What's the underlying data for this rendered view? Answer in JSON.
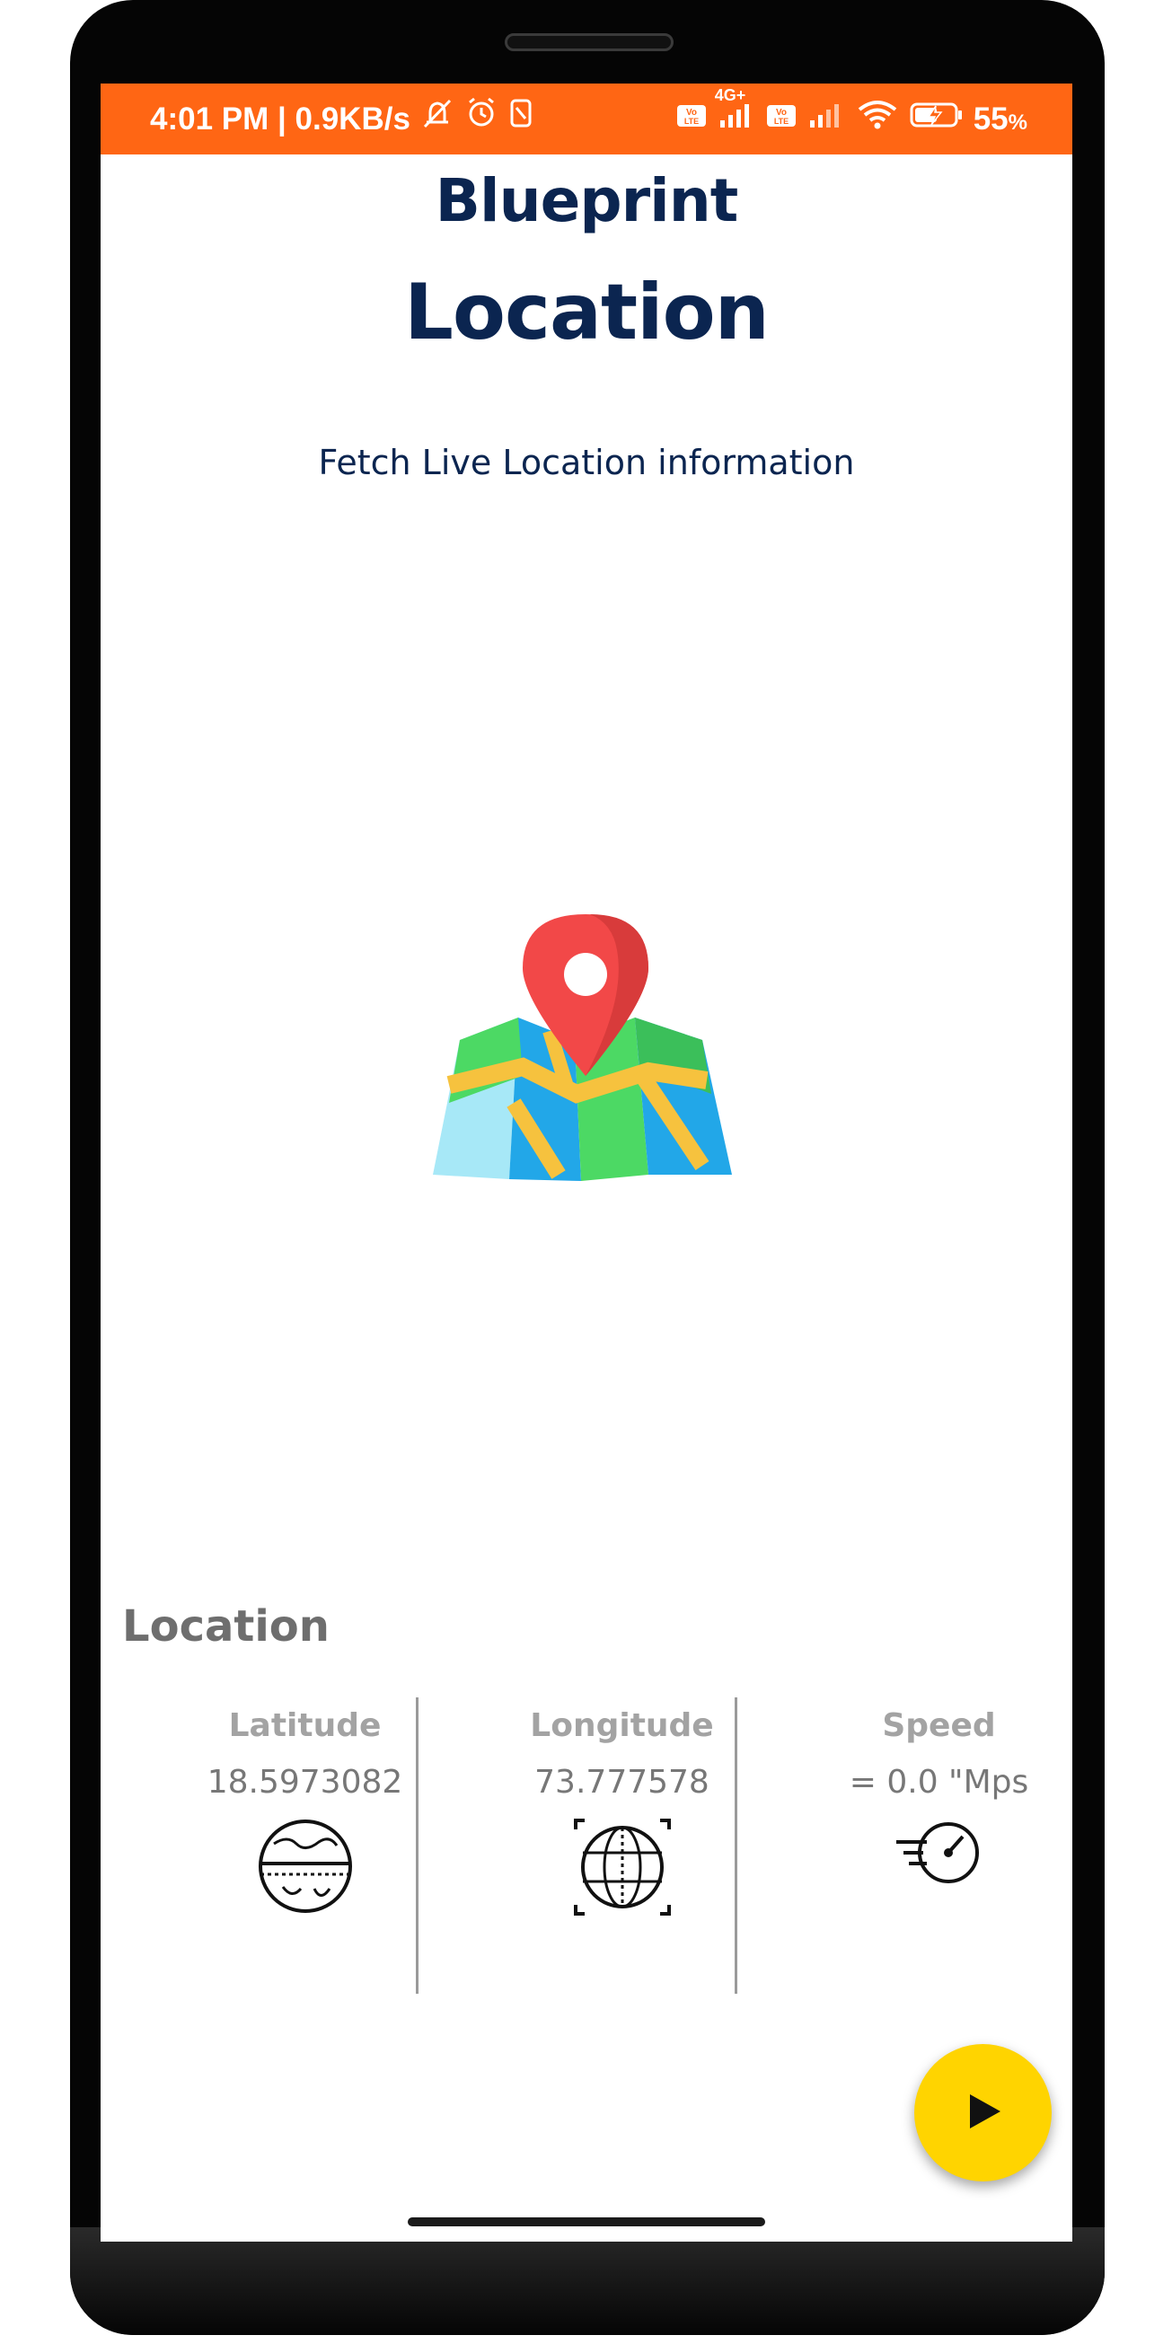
{
  "status_bar": {
    "time_and_speed": "4:01 PM | 0.9KB/s",
    "network_4g": "4G+",
    "battery_percent": "55",
    "battery_unit": "%",
    "background_color": "#ff6614",
    "icons": [
      "mute-icon",
      "alarm-icon",
      "nfc-icon",
      "volte-icon",
      "signal-icon",
      "volte-icon",
      "signal-icon",
      "wifi-icon",
      "battery-charging-icon"
    ]
  },
  "header": {
    "app_name": "Blueprint",
    "page_title": "Location",
    "subtitle": "Fetch Live Location information"
  },
  "illustration": {
    "icon": "map-pin-icon"
  },
  "location_section": {
    "title": "Location",
    "cards": [
      {
        "label": "Latitude",
        "value": "18.5973082",
        "icon": "globe-latitude-icon"
      },
      {
        "label": "Longitude",
        "value": "73.777578",
        "icon": "globe-longitude-icon"
      },
      {
        "label": "Speed",
        "value": "= 0.0 \"Mps",
        "icon": "speedometer-icon"
      }
    ]
  },
  "fab": {
    "icon": "play-icon",
    "color": "#ffd400"
  }
}
